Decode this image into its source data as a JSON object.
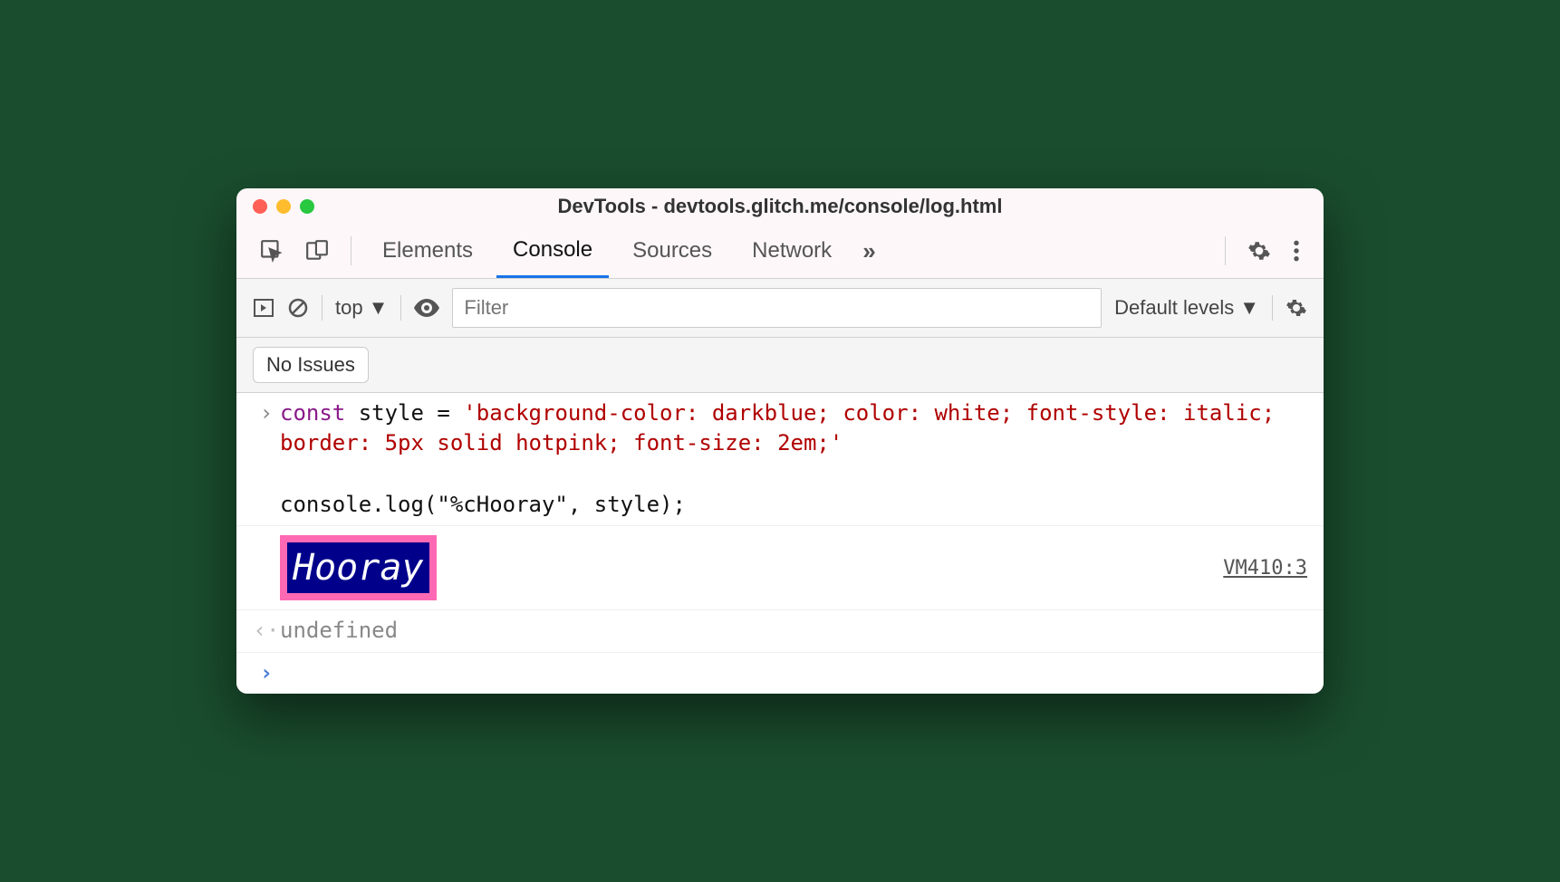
{
  "window": {
    "title": "DevTools - devtools.glitch.me/console/log.html"
  },
  "tabs": {
    "items": [
      "Elements",
      "Console",
      "Sources",
      "Network"
    ],
    "active": "Console"
  },
  "toolbar": {
    "context": "top",
    "filter_placeholder": "Filter",
    "levels_label": "Default levels"
  },
  "issues": {
    "label": "No Issues"
  },
  "console": {
    "input": {
      "line1_kw": "const",
      "line1_mid": " style = ",
      "line1_str": "'background-color: darkblue; color: white; font-style: italic; border: 5px solid hotpink; font-size: 2em;'",
      "line2": "console.log(\"%cHooray\", style);"
    },
    "output": {
      "text": "Hooray",
      "source": "VM410:3"
    },
    "return_value": "undefined"
  }
}
